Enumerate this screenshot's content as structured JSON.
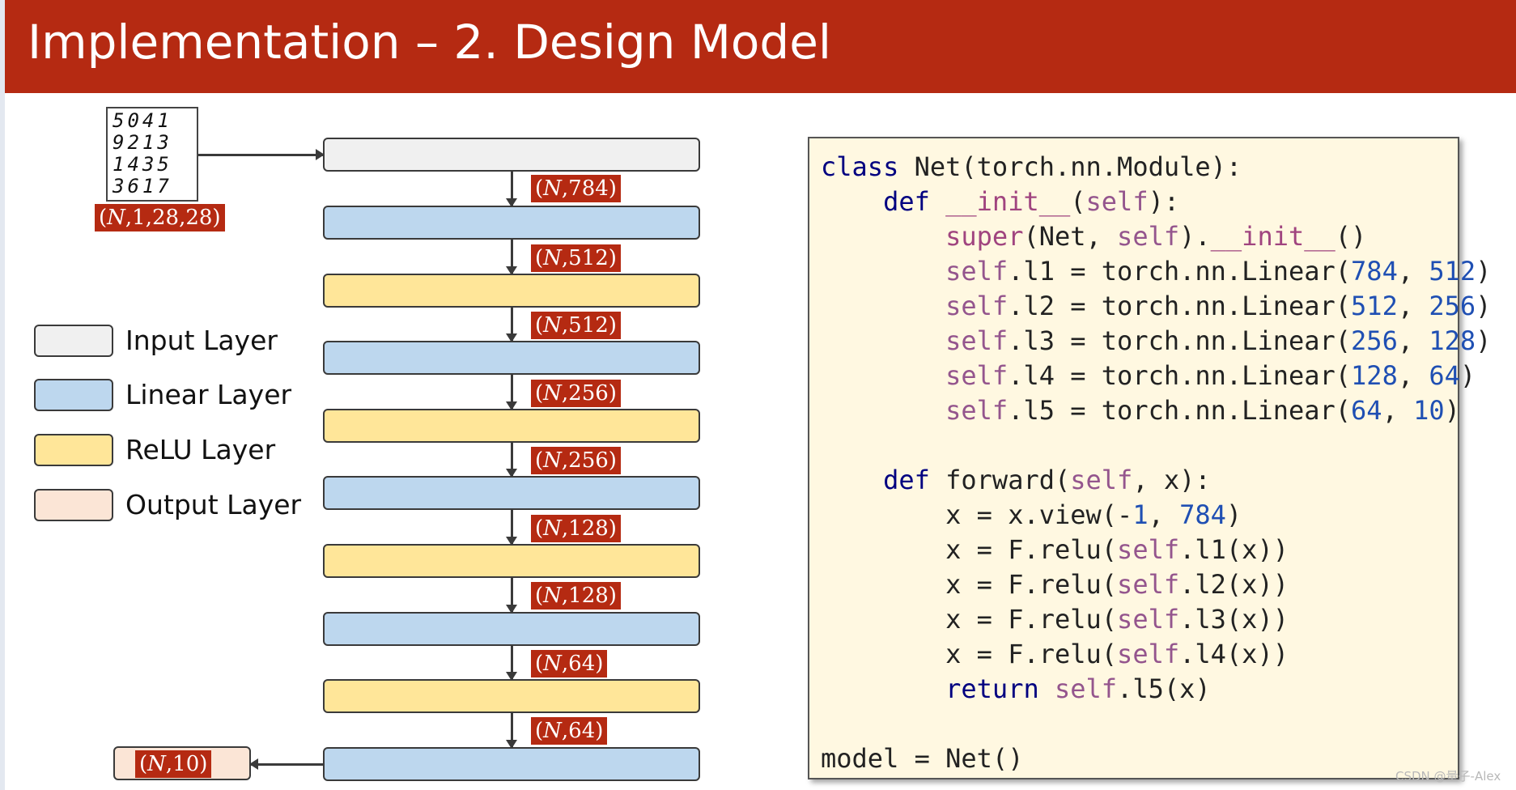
{
  "title": "Implementation – 2. Design Model",
  "input_image": {
    "digit_rows": [
      "5041",
      "9213",
      "1435",
      "3617"
    ],
    "shape_label": "1,28,28)"
  },
  "batch_symbol": "N",
  "layer_types": {
    "input": "#f0f0f0",
    "linear": "#bdd7ee",
    "relu": "#ffe699",
    "output": "#fbe5d6"
  },
  "shape_labels": [
    "784)",
    "512)",
    "512)",
    "256)",
    "256)",
    "128)",
    "128)",
    "64)",
    "64)"
  ],
  "output_shape_label": "10)",
  "legend": [
    {
      "label": "Input Layer",
      "color": "#f0f0f0"
    },
    {
      "label": "Linear Layer",
      "color": "#bdd7ee"
    },
    {
      "label": "ReLU Layer",
      "color": "#ffe699"
    },
    {
      "label": "Output Layer",
      "color": "#fbe5d6"
    }
  ],
  "code_lines": [
    "class Net(torch.nn.Module):",
    "    def __init__(self):",
    "        super(Net, self).__init__()",
    "        self.l1 = torch.nn.Linear(784, 512)",
    "        self.l2 = torch.nn.Linear(512, 256)",
    "        self.l3 = torch.nn.Linear(256, 128)",
    "        self.l4 = torch.nn.Linear(128, 64)",
    "        self.l5 = torch.nn.Linear(64, 10)",
    "",
    "    def forward(self, x):",
    "        x = x.view(-1, 784)",
    "        x = F.relu(self.l1(x))",
    "        x = F.relu(self.l2(x))",
    "        x = F.relu(self.l3(x))",
    "        x = F.relu(self.l4(x))",
    "        return self.l5(x)",
    "",
    "model = Net()"
  ],
  "watermark": "CSDN @量子-Alex",
  "colors": {
    "accent": "#b52a12",
    "keyword": "#000080",
    "self": "#94558d",
    "number": "#1f4fb3",
    "code_background": "#fff8e1"
  }
}
